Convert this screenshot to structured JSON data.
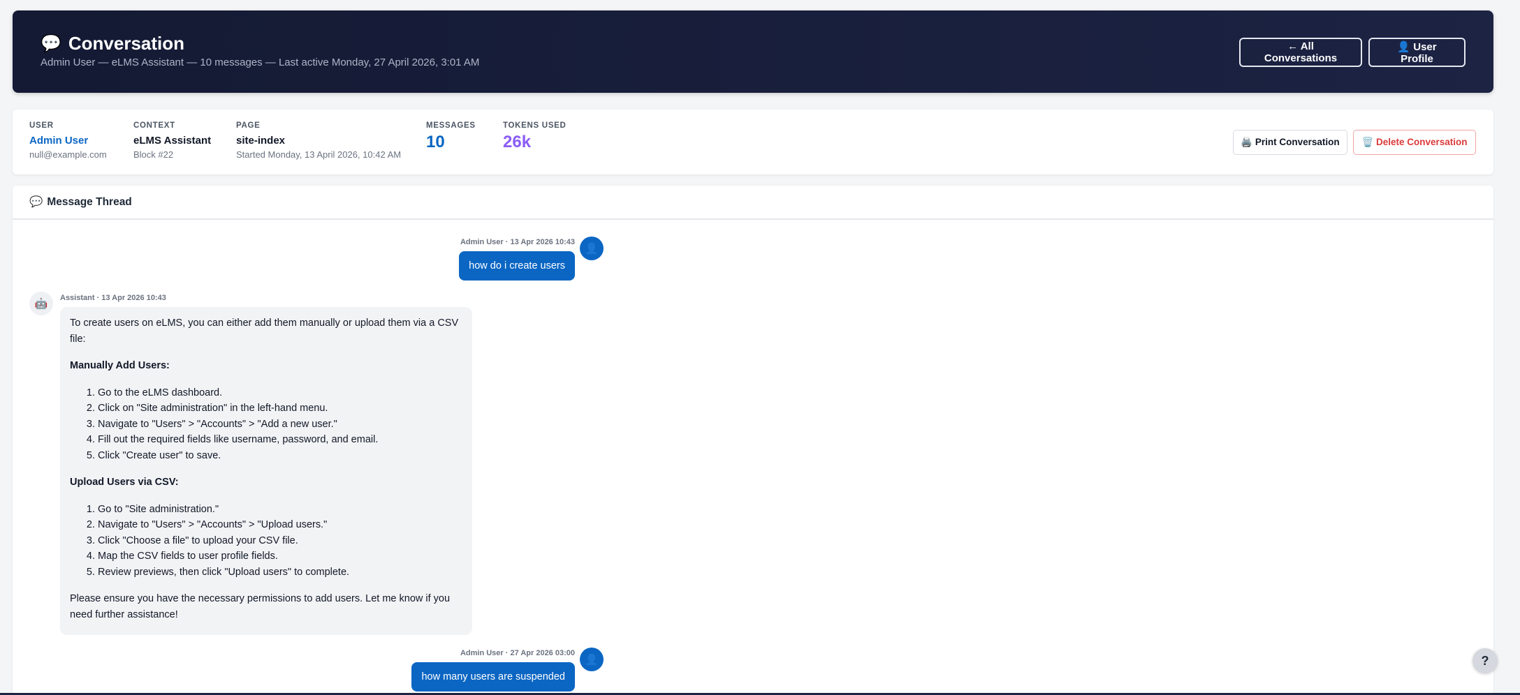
{
  "header": {
    "icon": "speech-bubble-icon",
    "icon_glyph": "💬",
    "title": "Conversation",
    "subtitle": "Admin User — eLMS Assistant — 10 messages — Last active Monday, 27 April 2026, 3:01 AM",
    "all_conversations": "← All Conversations",
    "user_profile": "👤 User Profile"
  },
  "info": {
    "user_label": "USER",
    "user_name": "Admin User",
    "user_email": "null@example.com",
    "context_label": "CONTEXT",
    "context_value": "eLMS Assistant",
    "context_sub": "Block #22",
    "page_label": "PAGE",
    "page_value": "site-index",
    "page_sub": "Started Monday, 13 April 2026, 10:42 AM",
    "messages_label": "MESSAGES",
    "messages_value": "10",
    "tokens_label": "TOKENS USED",
    "tokens_value": "26k",
    "print_button": "🖨️ Print Conversation",
    "delete_button": "🗑️ Delete Conversation"
  },
  "thread": {
    "icon_glyph": "💬",
    "title": "Message Thread",
    "messages": [
      {
        "role": "user",
        "meta": "Admin User · 13 Apr 2026 10:43",
        "text": "how do i create users"
      },
      {
        "role": "assistant",
        "meta": "Assistant · 13 Apr 2026 10:43",
        "intro": "To create users on eLMS, you can either add them manually or upload them via a CSV file:",
        "section1_title": "Manually Add Users:",
        "section1_steps": [
          "Go to the eLMS dashboard.",
          "Click on \"Site administration\" in the left-hand menu.",
          "Navigate to \"Users\" > \"Accounts\" > \"Add a new user.\"",
          "Fill out the required fields like username, password, and email.",
          "Click \"Create user\" to save."
        ],
        "section2_title": "Upload Users via CSV:",
        "section2_steps": [
          "Go to \"Site administration.\"",
          "Navigate to \"Users\" > \"Accounts\" > \"Upload users.\"",
          "Click \"Choose a file\" to upload your CSV file.",
          "Map the CSV fields to user profile fields.",
          "Review previews, then click \"Upload users\" to complete."
        ],
        "outro": "Please ensure you have the necessary permissions to add users. Let me know if you need further assistance!"
      },
      {
        "role": "user",
        "meta": "Admin User · 27 Apr 2026 03:00",
        "text": "how many users are suspended"
      }
    ]
  },
  "avatars": {
    "user_icon": "user-icon",
    "user_glyph": "👤",
    "bot_icon": "robot-icon",
    "bot_glyph": "🤖"
  },
  "help": {
    "icon": "help-icon",
    "glyph": "?"
  },
  "colors": {
    "header_bg": "#141a33",
    "accent_blue": "#0b66c3",
    "tokens_purple": "#8b5cf6",
    "delete_red": "#dc3a3a"
  }
}
